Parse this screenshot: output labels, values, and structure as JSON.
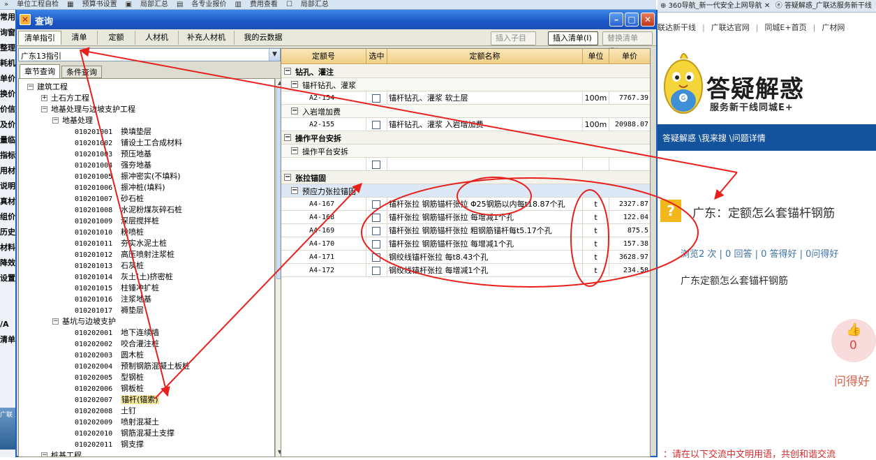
{
  "background_app": {
    "top_items": [
      "»",
      "单位工程自检",
      "▦",
      "预算书设置",
      "▣",
      "局部汇总",
      "▤",
      "各专业报价",
      "▥",
      "费用查看",
      "☐",
      "局部汇总"
    ],
    "left_items": [
      "常用",
      "询窗",
      "整理",
      "耗机",
      "单价",
      "换价",
      "价信",
      "及价",
      "量临",
      "指标",
      "用材",
      "说明",
      "真材",
      "组价",
      "历史",
      "材料",
      "降效",
      "设置",
      "",
      "",
      "/A",
      "清单",
      ""
    ],
    "tile_label": "广联\n工程"
  },
  "window": {
    "title": "查询",
    "tabs": [
      "清单指引",
      "清单",
      "定额",
      "人材机",
      "补充人材机",
      "我的云数据"
    ],
    "toolbar": {
      "insert_child": "插入子目",
      "insert_list": "插入清单(I)",
      "replace_list": "替换清单(R)"
    },
    "region_select": "广东13指引",
    "subtabs": [
      "章节查询",
      "条件查询"
    ],
    "tree": [
      {
        "level": 0,
        "exp": "-",
        "label": "建筑工程"
      },
      {
        "level": 1,
        "exp": "+",
        "label": "土石方工程"
      },
      {
        "level": 1,
        "exp": "-",
        "label": "地基处理与边坡支护工程"
      },
      {
        "level": 2,
        "exp": "-",
        "label": "地基处理"
      },
      {
        "level": 3,
        "code": "010201001",
        "label": "换填垫层"
      },
      {
        "level": 3,
        "code": "010201002",
        "label": "铺设土工合成材料"
      },
      {
        "level": 3,
        "code": "010201003",
        "label": "预压地基"
      },
      {
        "level": 3,
        "code": "010201004",
        "label": "强夯地基"
      },
      {
        "level": 3,
        "code": "010201005",
        "label": "振冲密实(不填料)"
      },
      {
        "level": 3,
        "code": "010201006",
        "label": "振冲桩(填料)"
      },
      {
        "level": 3,
        "code": "010201007",
        "label": "砂石桩"
      },
      {
        "level": 3,
        "code": "010201008",
        "label": "水泥粉煤灰碎石桩"
      },
      {
        "level": 3,
        "code": "010201009",
        "label": "深层搅拌桩"
      },
      {
        "level": 3,
        "code": "010201010",
        "label": "粉喷桩"
      },
      {
        "level": 3,
        "code": "010201011",
        "label": "夯实水泥土桩"
      },
      {
        "level": 3,
        "code": "010201012",
        "label": "高压喷射注浆桩"
      },
      {
        "level": 3,
        "code": "010201013",
        "label": "石灰桩"
      },
      {
        "level": 3,
        "code": "010201014",
        "label": "灰土(土)挤密桩"
      },
      {
        "level": 3,
        "code": "010201015",
        "label": "柱锤冲扩桩"
      },
      {
        "level": 3,
        "code": "010201016",
        "label": "注浆地基"
      },
      {
        "level": 3,
        "code": "010201017",
        "label": "褥垫层"
      },
      {
        "level": 2,
        "exp": "-",
        "label": "基坑与边坡支护"
      },
      {
        "level": 3,
        "code": "010202001",
        "label": "地下连续墙"
      },
      {
        "level": 3,
        "code": "010202002",
        "label": "咬合灌注桩"
      },
      {
        "level": 3,
        "code": "010202003",
        "label": "圆木桩"
      },
      {
        "level": 3,
        "code": "010202004",
        "label": "预制钢筋混凝土板桩"
      },
      {
        "level": 3,
        "code": "010202005",
        "label": "型钢桩"
      },
      {
        "level": 3,
        "code": "010202006",
        "label": "钢板桩"
      },
      {
        "level": 3,
        "code": "010202007",
        "label": "锚杆(锚索)",
        "selected": true
      },
      {
        "level": 3,
        "code": "010202008",
        "label": "土钉"
      },
      {
        "level": 3,
        "code": "010202009",
        "label": "喷射混凝土"
      },
      {
        "level": 3,
        "code": "010202010",
        "label": "钢筋混凝土支撑"
      },
      {
        "level": 3,
        "code": "010202011",
        "label": "钢支撑"
      },
      {
        "level": 1,
        "exp": "-",
        "label": "桩基工程"
      }
    ],
    "grid": {
      "headers": [
        "定额号",
        "选中",
        "定额名称",
        "单位",
        "单价"
      ],
      "rows": [
        {
          "type": "group",
          "title": "钻孔、灌注"
        },
        {
          "type": "sub",
          "title": "锚杆钻孔、灌浆"
        },
        {
          "type": "item",
          "code": "A2-154",
          "name": "锚杆钻孔、灌浆 软土层",
          "unit": "100m",
          "price": "7767.39"
        },
        {
          "type": "sub",
          "title": "入岩增加费"
        },
        {
          "type": "item",
          "code": "A2-155",
          "name": "锚杆钻孔、灌浆 入岩增加费",
          "unit": "100m",
          "price": "20988.07"
        },
        {
          "type": "group",
          "title": "操作平台安拆"
        },
        {
          "type": "sub",
          "title": "操作平台安拆"
        },
        {
          "type": "item",
          "code": "",
          "name": "",
          "unit": "",
          "price": ""
        },
        {
          "type": "group",
          "title": "张拉锚固"
        },
        {
          "type": "sub",
          "title": "预应力张拉锚固",
          "highlight": true
        },
        {
          "type": "item",
          "code": "A4-167",
          "name": "锚杆张拉 钢筋锚杆张拉 Φ25钢筋以内每t18.87个孔",
          "unit": "t",
          "price": "2327.87"
        },
        {
          "type": "item",
          "code": "A4-168",
          "name": "锚杆张拉 钢筋锚杆张拉 每增减1个孔",
          "unit": "t",
          "price": "122.04"
        },
        {
          "type": "item",
          "code": "A4-169",
          "name": "锚杆张拉 钢筋锚杆张拉 粗钢筋锚杆每t5.17个孔",
          "unit": "t",
          "price": "875.5"
        },
        {
          "type": "item",
          "code": "A4-170",
          "name": "锚杆张拉 钢筋锚杆张拉 每增减1个孔",
          "unit": "t",
          "price": "157.38"
        },
        {
          "type": "item",
          "code": "A4-171",
          "name": "钢绞线锚杆张拉 每t8.43个孔",
          "unit": "t",
          "price": "3628.97"
        },
        {
          "type": "item",
          "code": "A4-172",
          "name": "钢绞线锚杆张拉 每增减1个孔",
          "unit": "t",
          "price": "234.58"
        }
      ]
    }
  },
  "browser": {
    "tabs": [
      "360导航_新一代安全上网导航",
      "答疑解惑_广联达服务新干线"
    ],
    "nav": [
      "联达新干线",
      "广联达官网",
      "同城E+首页",
      "广材网"
    ],
    "logo_title": "答疑解惑",
    "logo_sub": "服务新干线同城E+",
    "breadcrumb": "答疑解惑 \\我来搜 \\问题详情",
    "question_title": "广东：定额怎么套锚杆钢筋",
    "stats": "浏览2 次 | 0 回答 | 0 答得好 | 0问得好",
    "question_body": "广东定额怎么套锚杆钢筋",
    "like_count": "0",
    "like_label": "问得好",
    "notice": "：请在以下交流中文明用语，共创和谐交流"
  },
  "colors": {
    "accent_red": "#e8201c",
    "title_blue": "#1c57c7",
    "bar_blue": "#13529c",
    "header_gold": "#f0cf86"
  }
}
